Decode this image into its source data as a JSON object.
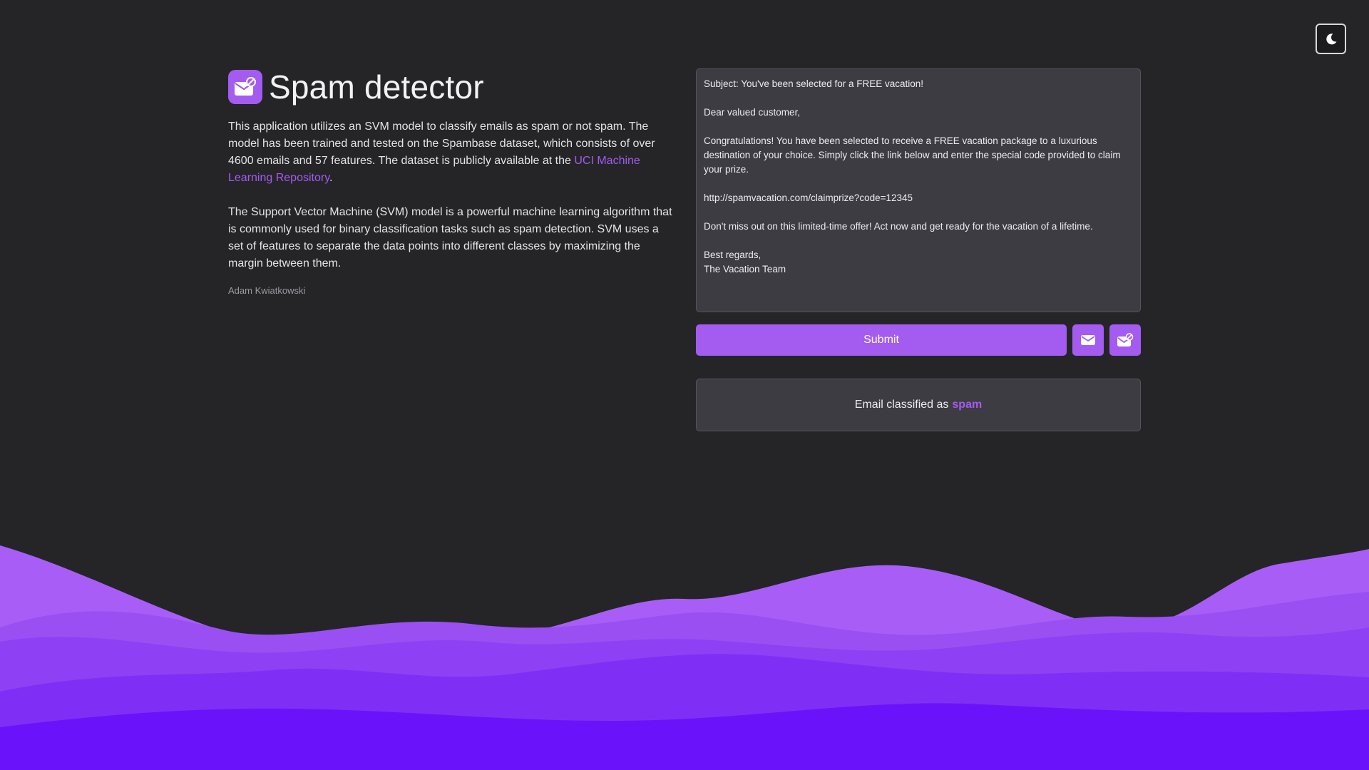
{
  "header": {
    "title": "Spam detector",
    "theme_toggle_icon": "moon-icon"
  },
  "intro": {
    "paragraph1_before_link": "This application utilizes an SVM model to classify emails as spam or not spam. The model has been trained and tested on the Spambase dataset, which consists of over 4600 emails and 57 features. The dataset is publicly available at the ",
    "link_text": "UCI Machine Learning Repository",
    "paragraph1_after_link": ".",
    "paragraph2": "The Support Vector Machine (SVM) model is a powerful machine learning algorithm that is commonly used for binary classification tasks such as spam detection. SVM uses a set of features to separate the data points into different classes by maximizing the margin between them.",
    "author": "Adam Kwiatkowski"
  },
  "email": {
    "value": "Subject: You've been selected for a FREE vacation!\n\nDear valued customer,\n\nCongratulations! You have been selected to receive a FREE vacation package to a luxurious destination of your choice. Simply click the link below and enter the special code provided to claim your prize.\n\nhttp://spamvacation.com/claimprize?code=12345\n\nDon't miss out on this limited-time offer! Act now and get ready for the vacation of a lifetime.\n\nBest regards,\nThe Vacation Team"
  },
  "actions": {
    "submit_label": "Submit",
    "ham_example_icon": "envelope-icon",
    "spam_example_icon": "envelope-blocked-icon"
  },
  "result": {
    "prefix": "Email classified as",
    "label": "spam"
  },
  "colors": {
    "accent": "#a45bf0",
    "background": "#252528",
    "panel": "#3c3c42"
  }
}
